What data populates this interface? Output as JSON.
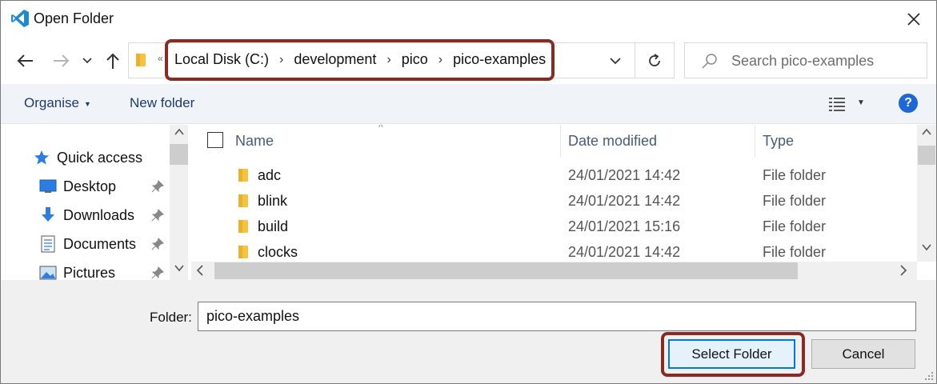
{
  "window": {
    "title": "Open Folder",
    "app_icon": "vscode-icon",
    "close_icon": "close-icon"
  },
  "navigation": {
    "back_icon": "back-arrow-icon",
    "forward_icon": "forward-arrow-icon",
    "recent_icon": "chevron-down-icon",
    "up_icon": "up-arrow-icon"
  },
  "address": {
    "overflow": "«",
    "crumbs": [
      "Local Disk (C:)",
      "development",
      "pico",
      "pico-examples"
    ],
    "separator": "›"
  },
  "search": {
    "placeholder": "Search pico-examples"
  },
  "commandbar": {
    "organise": "Organise",
    "new_folder": "New folder",
    "help": "?"
  },
  "sidebar": {
    "items": [
      {
        "label": "Quick access",
        "icon": "star-icon",
        "pinned": false
      },
      {
        "label": "Desktop",
        "icon": "desktop-icon",
        "pinned": true
      },
      {
        "label": "Downloads",
        "icon": "download-icon",
        "pinned": true
      },
      {
        "label": "Documents",
        "icon": "documents-icon",
        "pinned": true
      },
      {
        "label": "Pictures",
        "icon": "pictures-icon",
        "pinned": true
      }
    ]
  },
  "filelist": {
    "columns": [
      "Name",
      "Date modified",
      "Type"
    ],
    "rows": [
      {
        "name": "adc",
        "date": "24/01/2021 14:42",
        "type": "File folder"
      },
      {
        "name": "blink",
        "date": "24/01/2021 14:42",
        "type": "File folder"
      },
      {
        "name": "build",
        "date": "24/01/2021 15:16",
        "type": "File folder"
      },
      {
        "name": "clocks",
        "date": "24/01/2021 14:42",
        "type": "File folder"
      }
    ]
  },
  "footer": {
    "folder_label": "Folder:",
    "folder_value": "pico-examples",
    "select_label": "Select Folder",
    "cancel_label": "Cancel"
  },
  "colors": {
    "accent": "#0078d7",
    "highlight": "#8b2a22",
    "folder": "#f4c340",
    "link": "#1e3b6e"
  }
}
